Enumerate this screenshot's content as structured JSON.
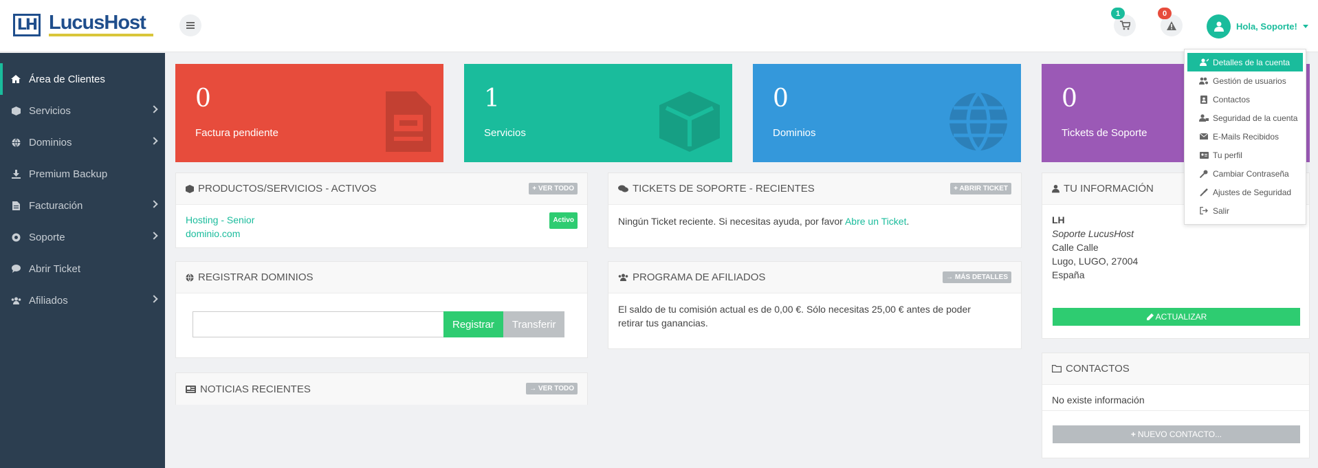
{
  "brand": {
    "mark": "LH",
    "name": "LucusHost"
  },
  "header": {
    "cart_badge": "1",
    "alerts_badge": "0",
    "greeting": "Hola, Soporte!"
  },
  "sidebar": {
    "items": [
      {
        "label": "Área de Clientes"
      },
      {
        "label": "Servicios"
      },
      {
        "label": "Dominios"
      },
      {
        "label": "Premium Backup"
      },
      {
        "label": "Facturación"
      },
      {
        "label": "Soporte"
      },
      {
        "label": "Abrir Ticket"
      },
      {
        "label": "Afiliados"
      }
    ]
  },
  "tiles": [
    {
      "value": "0",
      "label": "Factura pendiente",
      "color": "#e74c3c"
    },
    {
      "value": "1",
      "label": "Servicios",
      "color": "#1abc9c"
    },
    {
      "value": "0",
      "label": "Dominios",
      "color": "#3498db"
    },
    {
      "value": "0",
      "label": "Tickets de Soporte",
      "color": "#9b59b6"
    }
  ],
  "products": {
    "title": "PRODUCTOS/SERVICIOS - ACTIVOS",
    "button": "VER TODO",
    "service_name": "Hosting - Senior",
    "service_domain": "dominio.com",
    "status": "Activo"
  },
  "tickets": {
    "title": "TICKETS DE SOPORTE - RECIENTES",
    "button": "ABRIR TICKET",
    "text": "Ningún Ticket reciente. Si necesitas ayuda, por favor ",
    "link": "Abre un Ticket",
    "suffix": "."
  },
  "domains": {
    "title": "REGISTRAR DOMINIOS",
    "register": "Registrar",
    "transfer": "Transferir"
  },
  "affiliates": {
    "title": "PROGRAMA DE AFILIADOS",
    "button": "MÁS DETALLES",
    "line1": "El saldo de tu comisión actual es de 0,00 €. Sólo necesitas 25,00 € antes de poder",
    "line2": "retirar tus ganancias."
  },
  "news": {
    "title": "NOTICIAS RECIENTES",
    "button": "VER TODO"
  },
  "info": {
    "title": "TU INFORMACIÓN",
    "initials": "LH",
    "company": "Soporte LucusHost",
    "street": "Calle Calle",
    "city": "Lugo, LUGO, 27004",
    "country": "España",
    "update": "ACTUALIZAR"
  },
  "contacts": {
    "title": "CONTACTOS",
    "empty": "No existe información",
    "new": "NUEVO CONTACTO..."
  },
  "dropdown": {
    "items": [
      {
        "label": "Detalles de la cuenta"
      },
      {
        "label": "Gestión de usuarios"
      },
      {
        "label": "Contactos"
      },
      {
        "label": "Seguridad de la cuenta"
      },
      {
        "label": "E-Mails Recibidos"
      },
      {
        "label": "Tu perfil"
      },
      {
        "label": "Cambiar Contraseña"
      },
      {
        "label": "Ajustes de Seguridad"
      },
      {
        "label": "Salir"
      }
    ]
  }
}
